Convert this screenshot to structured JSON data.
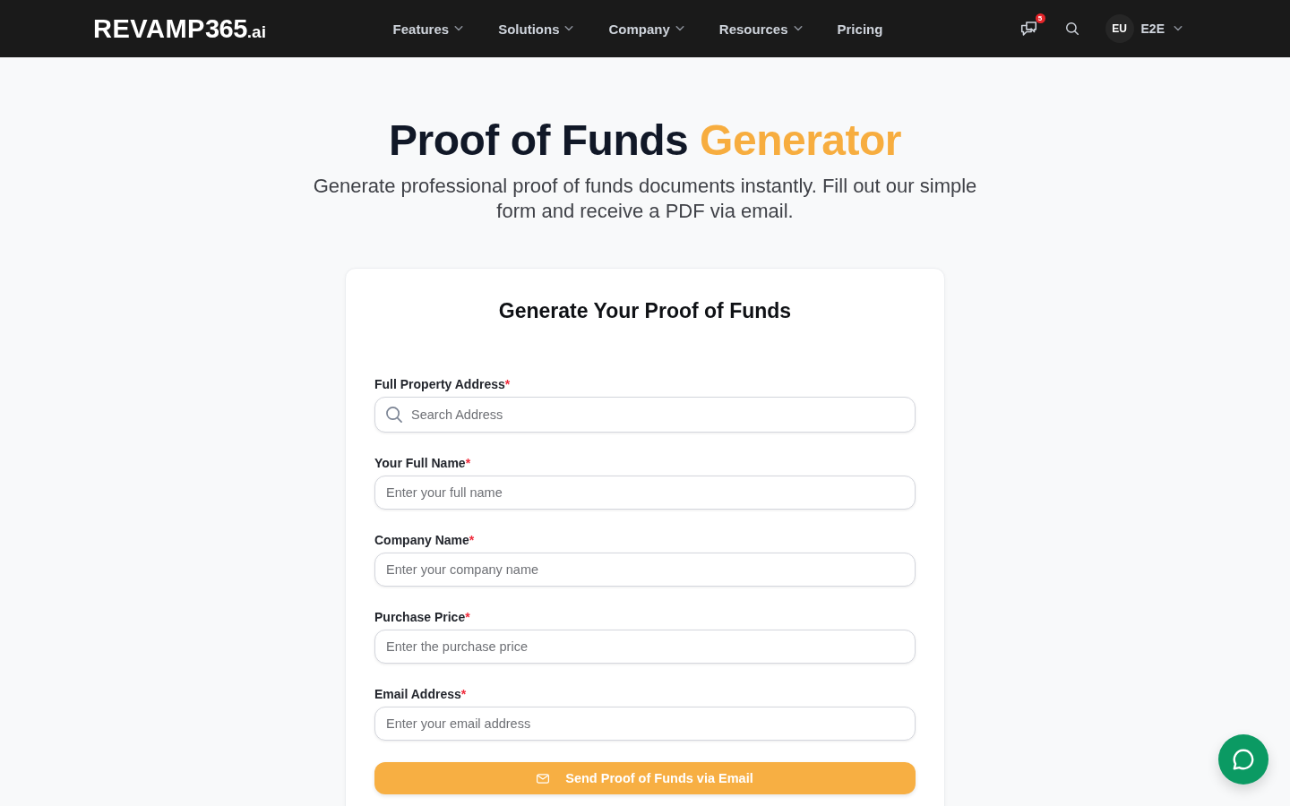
{
  "header": {
    "logo": {
      "wordmark": "REVAMP",
      "number": "365",
      "suffix": ".ai"
    },
    "nav": [
      {
        "label": "Features",
        "dropdown": true
      },
      {
        "label": "Solutions",
        "dropdown": true
      },
      {
        "label": "Company",
        "dropdown": true
      },
      {
        "label": "Resources",
        "dropdown": true
      },
      {
        "label": "Pricing",
        "dropdown": false
      }
    ],
    "messages": {
      "badge": "5"
    },
    "account": {
      "initials": "EU",
      "name": "E2E"
    }
  },
  "hero": {
    "title": "Proof of Funds",
    "title_highlight": "Generator",
    "subtitle": "Generate professional proof of funds documents instantly. Fill out our simple form and receive a PDF via email."
  },
  "form": {
    "heading": "Generate Your Proof of Funds",
    "fields": [
      {
        "kind": "search",
        "label": "Full Property Address",
        "required_marker": "*",
        "placeholder": "Search Address"
      },
      {
        "kind": "text",
        "label": "Your Full Name",
        "required_marker": "*",
        "placeholder": "Enter your full name"
      },
      {
        "kind": "text",
        "label": "Company Name",
        "required_marker": "*",
        "placeholder": "Enter your company name"
      },
      {
        "kind": "text",
        "label": "Purchase Price",
        "required_marker": "*",
        "placeholder": "Enter the purchase price"
      },
      {
        "kind": "text",
        "label": "Email Address",
        "required_marker": "*",
        "placeholder": "Enter your email address"
      }
    ],
    "submit": {
      "label": "Send Proof of Funds via Email"
    }
  }
}
